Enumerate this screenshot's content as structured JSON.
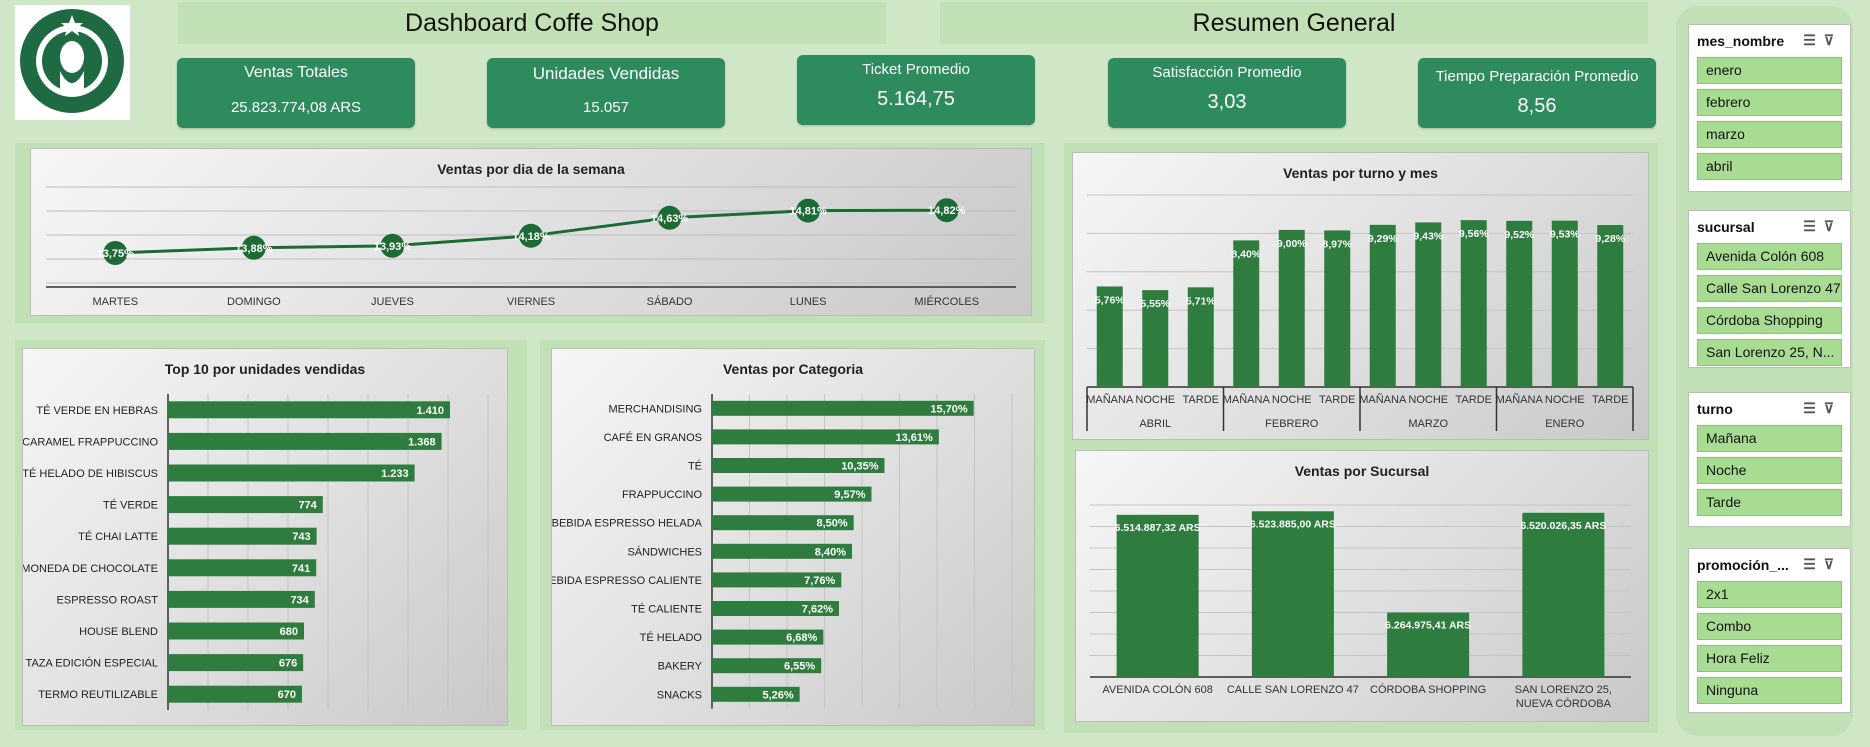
{
  "header": {
    "dashboard_title": "Dashboard Coffe Shop",
    "summary_title": "Resumen General"
  },
  "kpis": [
    {
      "label": "Ventas Totales",
      "value": "25.823.774,08 ARS"
    },
    {
      "label": "Unidades Vendidas",
      "value": "15.057"
    },
    {
      "label": "Ticket Promedio",
      "value": "5.164,75"
    },
    {
      "label": "Satisfacción Promedio",
      "value": "3,03"
    },
    {
      "label": "Tiempo Preparación Promedio",
      "value": "8,56"
    }
  ],
  "colors": {
    "bar": "#2e7d3e",
    "kpi": "#2e8b5e",
    "panel": "#c2e0b5",
    "page": "#cfe6c7",
    "slicer_item": "#a9dc93"
  },
  "chart_data": [
    {
      "type": "line",
      "title": "Ventas por dia de la semana",
      "categories": [
        "MARTES",
        "DOMINGO",
        "JUEVES",
        "VIERNES",
        "SÁBADO",
        "LUNES",
        "MIÉRCOLES"
      ],
      "values": [
        13.75,
        13.88,
        13.93,
        14.18,
        14.63,
        14.81,
        14.82
      ],
      "labels": [
        "13,75%",
        "13,88%",
        "13,93%",
        "14,18%",
        "14,63%",
        "14,81%",
        "14,82%"
      ],
      "ylim": [
        13.0,
        15.4
      ],
      "grid": true
    },
    {
      "type": "bar",
      "title": "Ventas por turno y mes",
      "groups": [
        "ABRIL",
        "FEBRERO",
        "MARZO",
        "ENERO"
      ],
      "categories": [
        "MAÑANA",
        "NOCHE",
        "TARDE"
      ],
      "values": [
        [
          5.76,
          5.55,
          5.71
        ],
        [
          8.4,
          9.0,
          8.97
        ],
        [
          9.29,
          9.43,
          9.56
        ],
        [
          9.52,
          9.53,
          9.28
        ]
      ],
      "labels": [
        [
          "5,76%",
          "5,55%",
          "5,71%"
        ],
        [
          "8,40%",
          "9,00%",
          "8,97%"
        ],
        [
          "9,29%",
          "9,43%",
          "9,56%"
        ],
        [
          "9,52%",
          "9,53%",
          "9,28%"
        ]
      ],
      "ylim": [
        0,
        11
      ],
      "grid": true
    },
    {
      "type": "bar",
      "orientation": "horizontal",
      "title": "Top 10  por unidades vendidas",
      "categories": [
        "TÉ VERDE EN HEBRAS",
        "CARAMEL FRAPPUCCINO",
        "TÉ HELADO DE HIBISCUS",
        "TÉ VERDE",
        "TÉ CHAI LATTE",
        "MONEDA DE CHOCOLATE",
        "ESPRESSO ROAST",
        "HOUSE BLEND",
        "TAZA EDICIÓN ESPECIAL",
        "TERMO REUTILIZABLE"
      ],
      "values": [
        1410,
        1368,
        1233,
        774,
        743,
        741,
        734,
        680,
        676,
        670
      ],
      "labels": [
        "1.410",
        "1.368",
        "1.233",
        "774",
        "743",
        "741",
        "734",
        "680",
        "676",
        "670"
      ],
      "xlim": [
        0,
        1600
      ],
      "grid": true
    },
    {
      "type": "bar",
      "orientation": "horizontal",
      "title": "Ventas por Categoria",
      "categories": [
        "MERCHANDISING",
        "CAFÉ EN GRANOS",
        "TÉ",
        "FRAPPUCCINO",
        "BEBIDA ESPRESSO HELADA",
        "SÁNDWICHES",
        "BEBIDA ESPRESSO CALIENTE",
        "TÉ CALIENTE",
        "TÉ HELADO",
        "BAKERY",
        "SNACKS"
      ],
      "values": [
        15.7,
        13.61,
        10.35,
        9.57,
        8.5,
        8.4,
        7.76,
        7.62,
        6.68,
        6.55,
        5.26
      ],
      "labels": [
        "15,70%",
        "13,61%",
        "10,35%",
        "9,57%",
        "8,50%",
        "8,40%",
        "7,76%",
        "7,62%",
        "6,68%",
        "6,55%",
        "5,26%"
      ],
      "xlim": [
        0,
        18
      ],
      "grid": true
    },
    {
      "type": "bar",
      "title": "Ventas por Sucursal",
      "categories": [
        "AVENIDA COLÓN 608",
        "CALLE SAN LORENZO 47",
        "CÓRDOBA SHOPPING",
        "SAN LORENZO 25, NUEVA CÓRDOBA"
      ],
      "values": [
        6514887.32,
        6523885.0,
        6264975.41,
        6520026.35
      ],
      "labels": [
        "6.514.887,32 ARS",
        "6.523.885,00 ARS",
        "6.264.975,41 ARS",
        "6.520.026,35 ARS"
      ],
      "ylim": [
        6100000,
        6540000
      ],
      "grid": true
    }
  ],
  "slicers": [
    {
      "title": "mes_nombre",
      "items": [
        "enero",
        "febrero",
        "marzo",
        "abril"
      ]
    },
    {
      "title": "sucursal",
      "items": [
        "Avenida Colón 608",
        "Calle San Lorenzo 47",
        "Córdoba Shopping",
        "San Lorenzo 25, N..."
      ]
    },
    {
      "title": "turno",
      "items": [
        "Mañana",
        "Noche",
        "Tarde"
      ]
    },
    {
      "title": "promoción_...",
      "items": [
        "2x1",
        "Combo",
        "Hora Feliz",
        "Ninguna"
      ]
    }
  ]
}
